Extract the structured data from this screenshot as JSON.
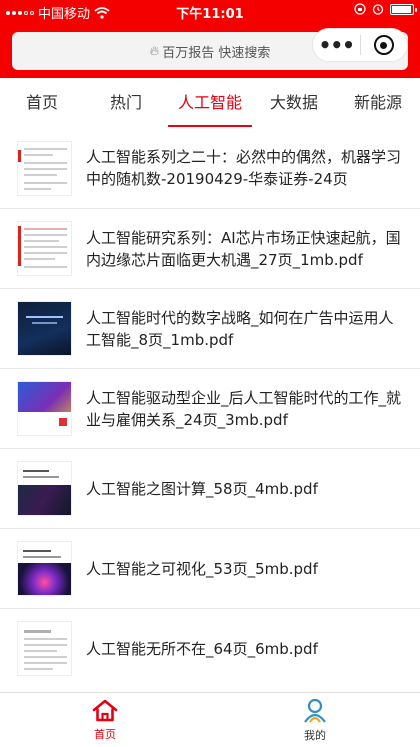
{
  "status_bar": {
    "carrier": "中国移动",
    "time": "下午11:01"
  },
  "header": {
    "search_placeholder": "百万报告 快速搜索",
    "more_label": "•••"
  },
  "tabs": [
    {
      "label": "首页",
      "active": false
    },
    {
      "label": "热门",
      "active": false
    },
    {
      "label": "人工智能",
      "active": true
    },
    {
      "label": "大数据",
      "active": false
    },
    {
      "label": "新能源",
      "active": false
    }
  ],
  "reports": [
    {
      "title": "人工智能系列之二十：必然中的偶然，机器学习中的随机数-20190429-华泰证券-24页",
      "thumb": "doc"
    },
    {
      "title": "人工智能研究系列：AI芯片市场正快速起航，国内边缘芯片面临更大机遇_27页_1mb.pdf",
      "thumb": "doc"
    },
    {
      "title": "人工智能时代的数字战略_如何在广告中运用人工智能_8页_1mb.pdf",
      "thumb": "dark1"
    },
    {
      "title": "人工智能驱动型企业_后人工智能时代的工作_就业与雇佣关系_24页_3mb.pdf",
      "thumb": "colorful"
    },
    {
      "title": "人工智能之图计算_58页_4mb.pdf",
      "thumb": "dark2"
    },
    {
      "title": "人工智能之可视化_53页_5mb.pdf",
      "thumb": "purple"
    },
    {
      "title": "人工智能无所不在_64页_6mb.pdf",
      "thumb": "doc"
    }
  ],
  "bottom_nav": [
    {
      "label": "首页",
      "icon": "home-icon",
      "active": true
    },
    {
      "label": "我的",
      "icon": "user-icon",
      "active": false
    }
  ],
  "colors": {
    "brand_red": "#f40000",
    "active_red": "#e60012",
    "user_icon_blue": "#2f8fc6",
    "user_icon_orange": "#f5a623"
  }
}
